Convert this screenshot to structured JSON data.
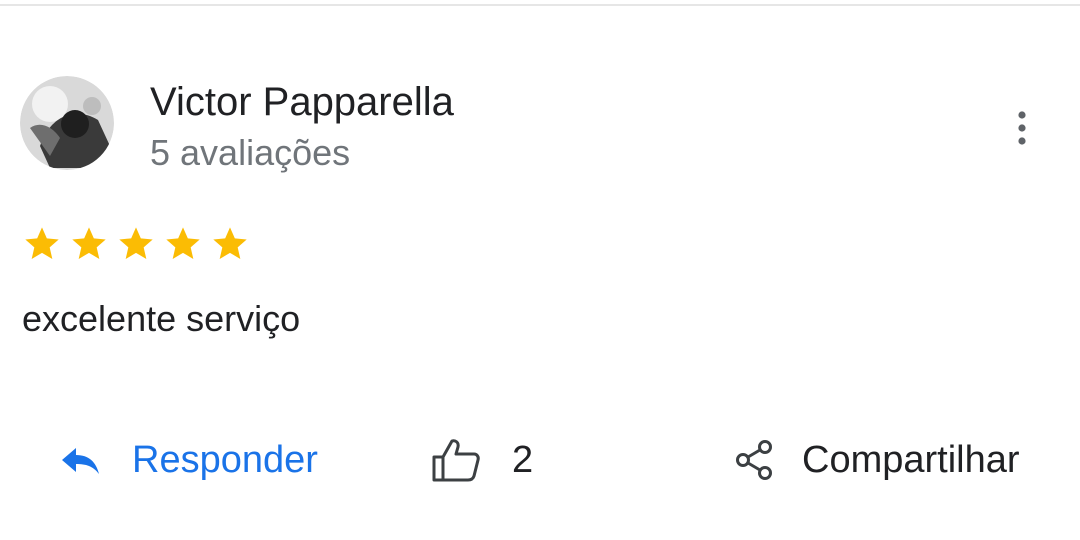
{
  "review": {
    "reviewer_name": "Victor Papparella",
    "review_count": "5 avaliações",
    "rating": 5,
    "max_rating": 5,
    "text": "excelente serviço"
  },
  "actions": {
    "reply_label": "Responder",
    "like_count": "2",
    "share_label": "Compartilhar"
  },
  "icons": {
    "reply": "reply-arrow-icon",
    "like": "thumbs-up-icon",
    "share": "share-icon",
    "more": "more-vert-icon",
    "star": "star-icon"
  },
  "colors": {
    "star": "#fbbc04",
    "link": "#1a73e8",
    "text_primary": "#202124",
    "text_secondary": "#70757a"
  }
}
